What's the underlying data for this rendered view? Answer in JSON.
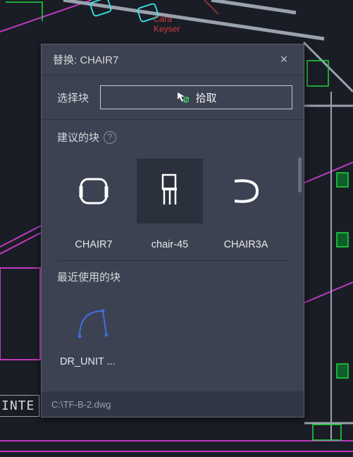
{
  "annotation": {
    "name": "Cara\nKeyser"
  },
  "dialog": {
    "title_prefix": "替换:",
    "title_block": "CHAIR7",
    "select_label": "选择块",
    "pick_label": "拾取",
    "suggested_label": "建议的块",
    "recent_label": "最近使用的块"
  },
  "suggested_blocks": [
    {
      "name": "CHAIR7"
    },
    {
      "name": "chair-45"
    },
    {
      "name": "CHAIR3A"
    }
  ],
  "recent_blocks": [
    {
      "name": "DR_UNIT ..."
    }
  ],
  "footer": {
    "path": "C:\\TF-B-2.dwg"
  },
  "bg": {
    "fragment": "INTE"
  }
}
